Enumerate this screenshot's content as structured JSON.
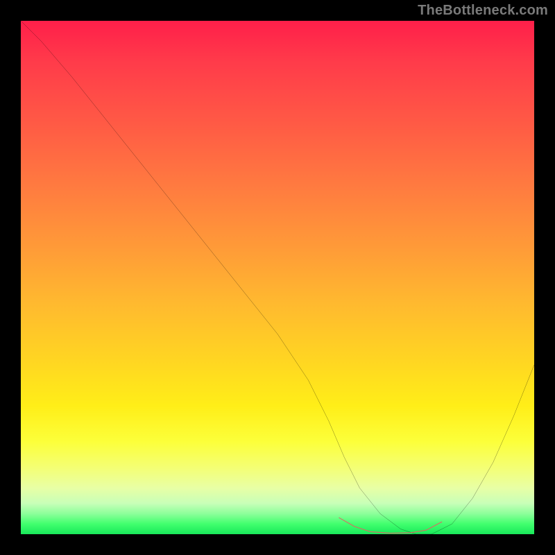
{
  "watermark": "TheBottleneck.com",
  "chart_data": {
    "type": "line",
    "title": "",
    "xlabel": "",
    "ylabel": "",
    "xlim": [
      0,
      100
    ],
    "ylim": [
      0,
      100
    ],
    "series": [
      {
        "name": "curve",
        "color": "#000000",
        "x": [
          0,
          4,
          10,
          18,
          26,
          34,
          42,
          50,
          56,
          60,
          63,
          66,
          70,
          74,
          77,
          80,
          84,
          88,
          92,
          96,
          100
        ],
        "y": [
          100,
          96,
          89,
          79,
          69,
          59,
          49,
          39,
          30,
          22,
          15,
          9,
          4,
          1,
          0,
          0,
          2,
          7,
          14,
          23,
          33
        ]
      },
      {
        "name": "bottom-highlight",
        "color": "#d86b63",
        "x": [
          62,
          65,
          68,
          72,
          76,
          79,
          82
        ],
        "y": [
          3.2,
          1.5,
          0.5,
          0.2,
          0.3,
          0.8,
          2.4
        ]
      }
    ],
    "gradient_stops": [
      {
        "pos": 0,
        "color": "#ff1f4a"
      },
      {
        "pos": 20,
        "color": "#ff5a45"
      },
      {
        "pos": 44,
        "color": "#ff9a38"
      },
      {
        "pos": 66,
        "color": "#ffd522"
      },
      {
        "pos": 82,
        "color": "#fcff3a"
      },
      {
        "pos": 94,
        "color": "#c8ffb8"
      },
      {
        "pos": 100,
        "color": "#18e85a"
      }
    ]
  }
}
